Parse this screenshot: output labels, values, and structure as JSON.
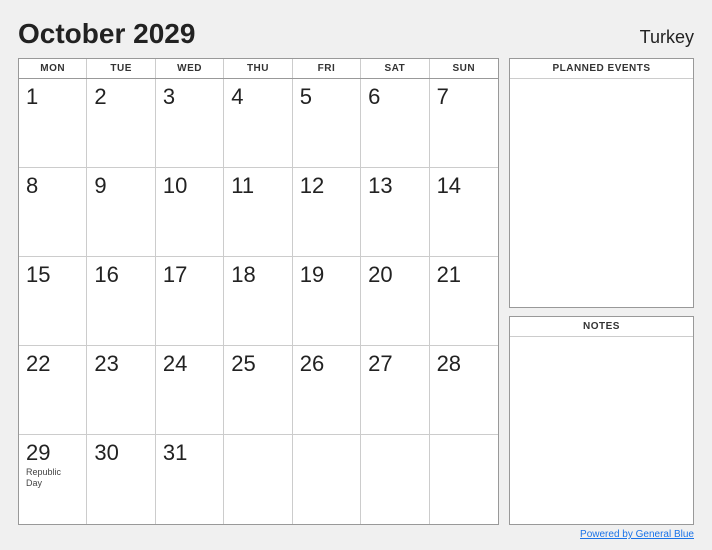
{
  "header": {
    "title": "October 2029",
    "country": "Turkey"
  },
  "calendar": {
    "day_headers": [
      "MON",
      "TUE",
      "WED",
      "THU",
      "FRI",
      "SAT",
      "SUN"
    ],
    "days": [
      {
        "num": "1",
        "event": ""
      },
      {
        "num": "2",
        "event": ""
      },
      {
        "num": "3",
        "event": ""
      },
      {
        "num": "4",
        "event": ""
      },
      {
        "num": "5",
        "event": ""
      },
      {
        "num": "6",
        "event": ""
      },
      {
        "num": "7",
        "event": ""
      },
      {
        "num": "8",
        "event": ""
      },
      {
        "num": "9",
        "event": ""
      },
      {
        "num": "10",
        "event": ""
      },
      {
        "num": "11",
        "event": ""
      },
      {
        "num": "12",
        "event": ""
      },
      {
        "num": "13",
        "event": ""
      },
      {
        "num": "14",
        "event": ""
      },
      {
        "num": "15",
        "event": ""
      },
      {
        "num": "16",
        "event": ""
      },
      {
        "num": "17",
        "event": ""
      },
      {
        "num": "18",
        "event": ""
      },
      {
        "num": "19",
        "event": ""
      },
      {
        "num": "20",
        "event": ""
      },
      {
        "num": "21",
        "event": ""
      },
      {
        "num": "22",
        "event": ""
      },
      {
        "num": "23",
        "event": ""
      },
      {
        "num": "24",
        "event": ""
      },
      {
        "num": "25",
        "event": ""
      },
      {
        "num": "26",
        "event": ""
      },
      {
        "num": "27",
        "event": ""
      },
      {
        "num": "28",
        "event": ""
      },
      {
        "num": "29",
        "event": "Republic Day"
      },
      {
        "num": "30",
        "event": ""
      },
      {
        "num": "31",
        "event": ""
      }
    ]
  },
  "planned_events": {
    "label": "PLANNED EVENTS"
  },
  "notes": {
    "label": "NOTES"
  },
  "footer": {
    "link_text": "Powered by General Blue",
    "link_url": "#"
  }
}
